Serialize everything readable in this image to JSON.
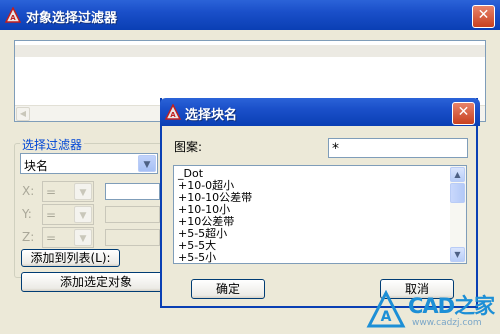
{
  "main_dialog": {
    "title": "对象选择过滤器",
    "close_glyph": "✕",
    "filter_group_label": "选择过滤器",
    "filter_type_value": "块名",
    "x_label": "X:",
    "y_label": "Y:",
    "z_label": "Z:",
    "operator_value": "=",
    "add_to_list_button": "添加到列表(L):",
    "add_selected_button": "添加选定对象"
  },
  "block_dialog": {
    "title": "选择块名",
    "close_glyph": "✕",
    "pattern_label": "图案:",
    "pattern_value": "*",
    "block_names": [
      "_Dot",
      "+10-0超小",
      "+10-10公差带",
      "+10-10小",
      "+10公差带",
      "+5-5超小",
      "+5-5大",
      "+5-5小"
    ],
    "ok_button": "确定",
    "cancel_button": "取消"
  },
  "watermark": {
    "brand": "CAD之家",
    "url": "www.cadzj.com"
  },
  "colors": {
    "titlebar": "#0a3fb4",
    "dialog_face": "#ece9d8",
    "group_label": "#0046d5",
    "close_button": "#c8401f",
    "watermark_blue": "#1d8fd6"
  }
}
